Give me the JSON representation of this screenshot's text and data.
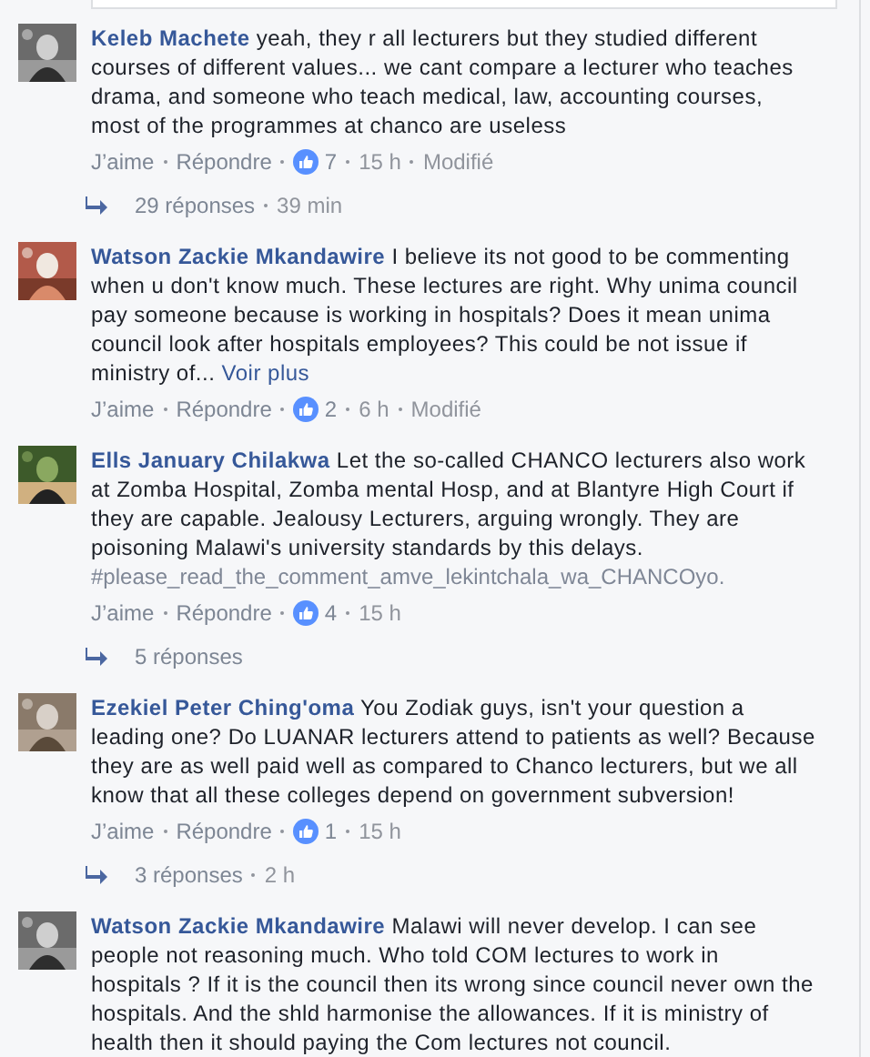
{
  "comments": [
    {
      "author": "Keleb Machete",
      "text": "yeah, they r all lecturers but they studied different courses of different values... we cant compare a lecturer who teaches drama, and someone who teach medical, law, accounting courses, most of the programmes at chanco are useless",
      "actions": {
        "like": "J’aime",
        "reply": "Répondre",
        "likes": "7",
        "time": "15 h",
        "edited": "Modifié"
      },
      "replies": {
        "count": "29 réponses",
        "time": "39 min"
      }
    },
    {
      "author": "Watson Zackie Mkandawire",
      "text": "I believe its not good to be commenting when u don't know much. These lectures are right. Why unima council pay someone because is working in hospitals? Does it mean unima council look after hospitals employees? This could be not issue if ministry of...",
      "see_more": "Voir plus",
      "actions": {
        "like": "J’aime",
        "reply": "Répondre",
        "likes": "2",
        "time": "6 h",
        "edited": "Modifié"
      }
    },
    {
      "author": "Ells January Chilakwa",
      "text": "Let the so-called CHANCO lecturers also work at Zomba Hospital, Zomba mental Hosp, and at Blantyre High Court if they are capable. Jealousy Lecturers, arguing wrongly. They are poisoning Malawi's university standards by this delays.",
      "hashtag": "#please_read_the_comment_amve_lekintchala_wa_CHANCOyo.",
      "actions": {
        "like": "J’aime",
        "reply": "Répondre",
        "likes": "4",
        "time": "15 h"
      },
      "replies": {
        "count": "5 réponses"
      }
    },
    {
      "author": "Ezekiel Peter Ching'oma",
      "text": "You Zodiak guys, isn't your question a leading one? Do LUANAR lecturers attend to patients as well? Because they are as well paid well as compared to Chanco lecturers, but we all know that all these colleges depend on government subversion!",
      "actions": {
        "like": "J’aime",
        "reply": "Répondre",
        "likes": "1",
        "time": "15 h"
      },
      "replies": {
        "count": "3 réponses",
        "time": "2 h"
      }
    },
    {
      "author": "Watson Zackie Mkandawire",
      "text": "Malawi will never develop. I can see people not reasoning much. Who told COM lectures to work in hospitals ? If it is the council then its wrong since council never own the hospitals. And the shld harmonise the allowances. If it is ministry of health then it should paying the Com lectures not council."
    }
  ]
}
